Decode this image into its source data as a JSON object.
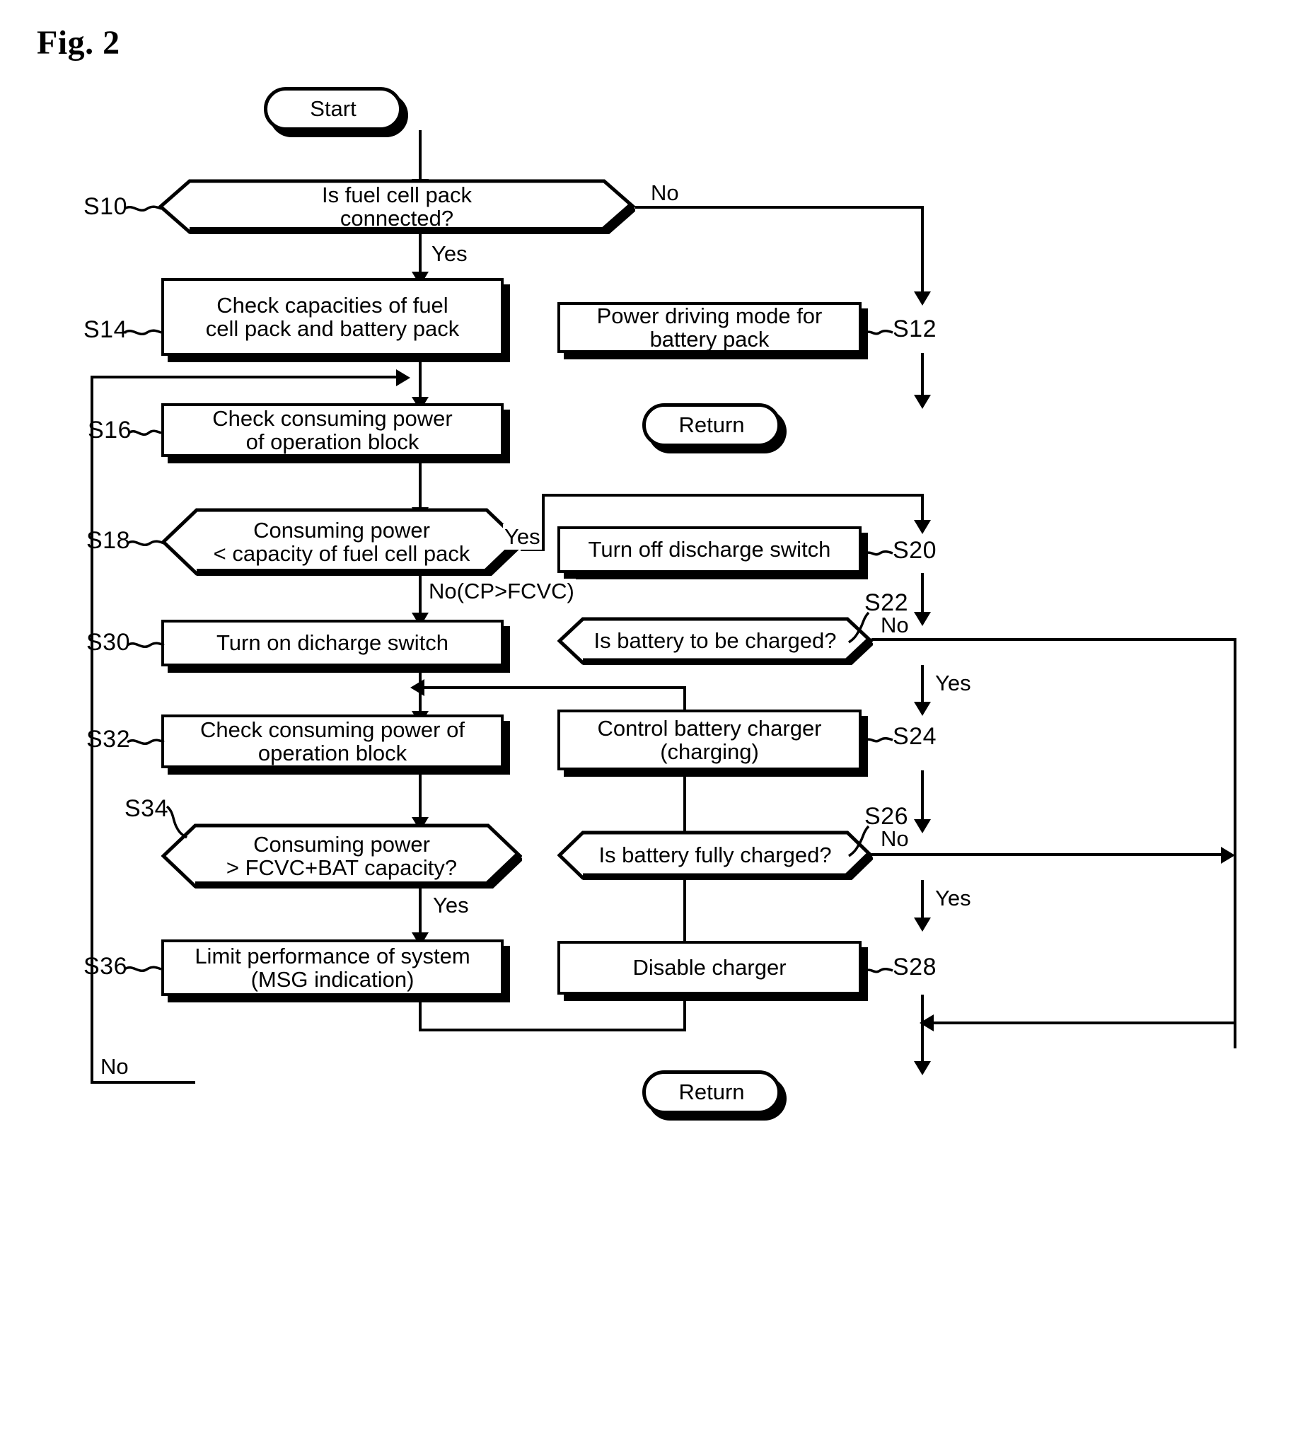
{
  "figure": {
    "label": "Fig. 2"
  },
  "nodes": {
    "start": {
      "ref": "",
      "text": "Start"
    },
    "s10": {
      "ref": "S10",
      "text": "Is fuel cell pack\nconnected?"
    },
    "s12": {
      "ref": "S12",
      "text": "Power driving mode for\nbattery pack"
    },
    "s14": {
      "ref": "S14",
      "text": "Check capacities of fuel\ncell pack and battery pack"
    },
    "return_right_top": {
      "ref": "",
      "text": "Return"
    },
    "s16": {
      "ref": "S16",
      "text": "Check consuming power\nof operation block"
    },
    "s18": {
      "ref": "S18",
      "text": "Consuming power\n< capacity of fuel cell pack"
    },
    "s20": {
      "ref": "S20",
      "text": "Turn off discharge switch"
    },
    "s22": {
      "ref": "S22",
      "text": "Is battery to be charged?"
    },
    "s24": {
      "ref": "S24",
      "text": "Control battery charger\n(charging)"
    },
    "s26": {
      "ref": "S26",
      "text": "Is battery fully charged?"
    },
    "s28": {
      "ref": "S28",
      "text": "Disable charger"
    },
    "s30": {
      "ref": "S30",
      "text": "Turn on dicharge switch"
    },
    "s32": {
      "ref": "S32",
      "text": "Check consuming power of\noperation block"
    },
    "s34": {
      "ref": "S34",
      "text": "Consuming power\n> FCVC+BAT capacity?"
    },
    "s36": {
      "ref": "S36",
      "text": "Limit performance of system\n(MSG indication)"
    },
    "return_bottom": {
      "ref": "",
      "text": "Return"
    }
  },
  "branch_labels": {
    "s10_no": "No",
    "s10_yes": "Yes",
    "s18_yes": "Yes",
    "s18_no": "No(CP>FCVC)",
    "s22_yes": "Yes",
    "s22_no": "No",
    "s26_yes": "Yes",
    "s26_no": "No",
    "s34_no": "No",
    "s34_yes": "Yes"
  },
  "colors": {
    "ink": "#000000",
    "paper": "#ffffff"
  }
}
